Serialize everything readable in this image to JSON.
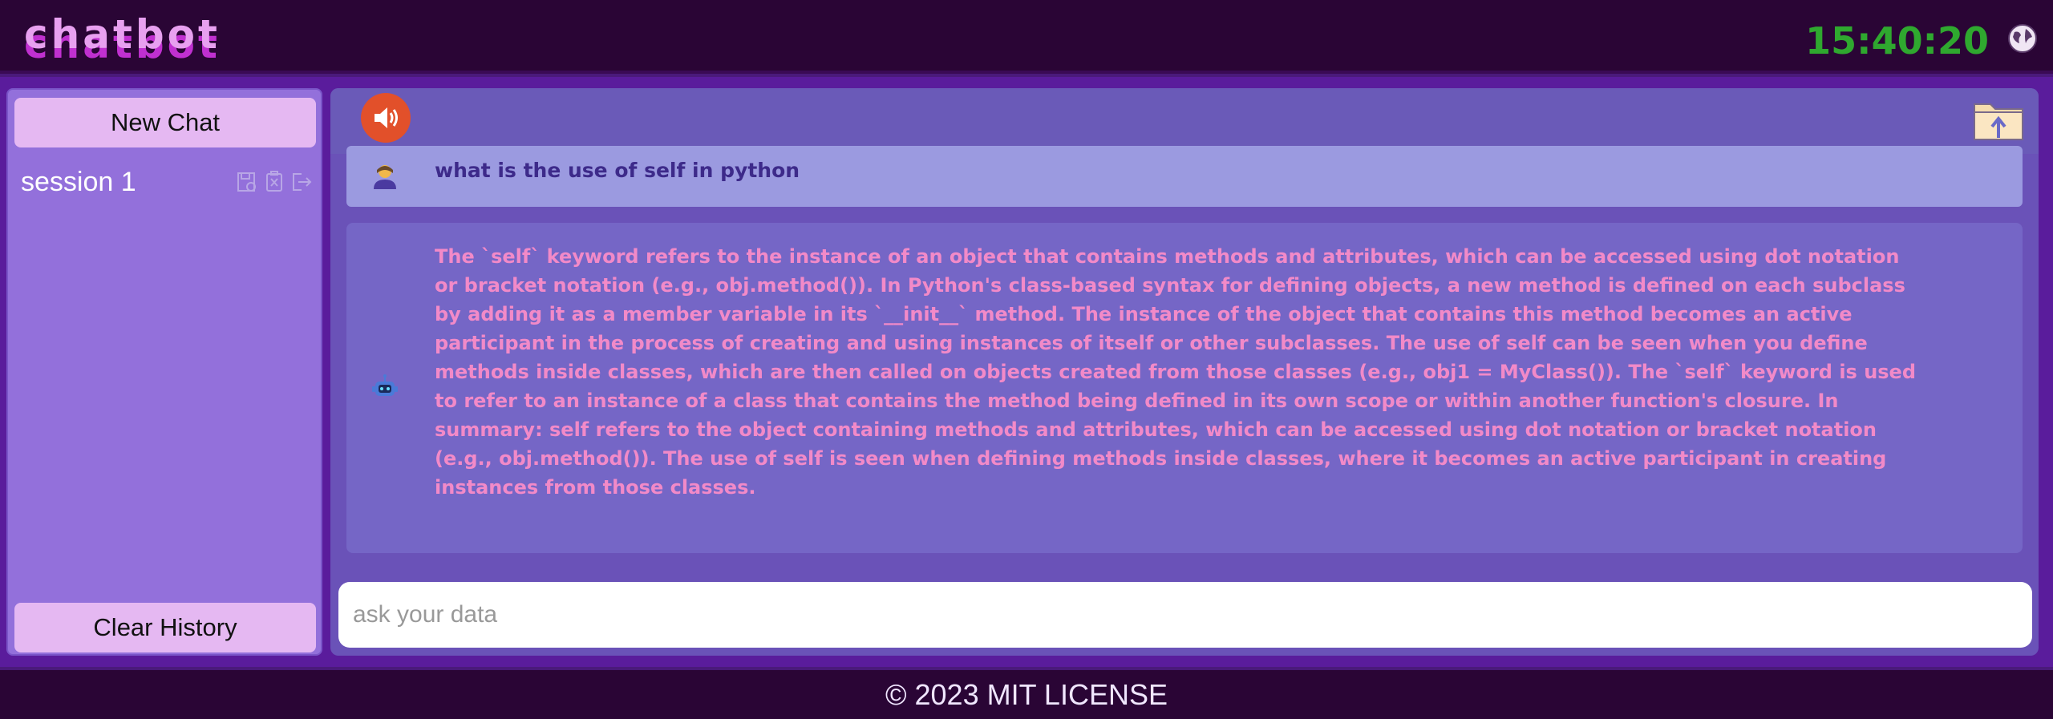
{
  "header": {
    "logo": "chatbot",
    "clock": "15:40:20",
    "globe_icon": "globe-icon"
  },
  "sidebar": {
    "new_chat_label": "New Chat",
    "sessions": [
      {
        "label": "session 1",
        "icons": [
          "save-icon",
          "delete-icon",
          "export-icon"
        ]
      }
    ],
    "clear_history_label": "Clear History"
  },
  "chat": {
    "speaker_icon": "speaker-icon",
    "upload_icon": "upload-folder-icon",
    "messages": [
      {
        "role": "user",
        "avatar": "user-avatar-icon",
        "text": "what is the use of self in python"
      },
      {
        "role": "bot",
        "avatar": "robot-icon",
        "text": "The `self` keyword refers to the instance of an object that contains methods and attributes, which can be accessed using dot notation or bracket notation (e.g., obj.method()). In Python's class-based syntax for defining objects, a new method is defined on each subclass by adding it as a member variable in its `__init__` method. The instance of the object that contains this method becomes an active participant in the process of creating and using instances of itself or other subclasses. The use of self can be seen when you define methods inside classes, which are then called on objects created from those classes (e.g., obj1 = MyClass()). The `self` keyword is used to refer to an instance of a class that contains the method being defined in its own scope or within another function's closure. In summary: self refers to the object containing methods and attributes, which can be accessed using dot notation or bracket notation (e.g., obj.method()). The use of self is seen when defining methods inside classes, where it becomes an active participant in creating instances from those classes."
      }
    ],
    "input_placeholder": "ask your data"
  },
  "footer": {
    "text": "© 2023 MIT LICENSE"
  },
  "colors": {
    "header_bg": "#2a0535",
    "sidebar_bg": "#9370db",
    "button_bg": "#e5b8f2",
    "clock": "#2fa82f",
    "bot_text": "#f28ac8",
    "user_text": "#3d2a8a"
  }
}
